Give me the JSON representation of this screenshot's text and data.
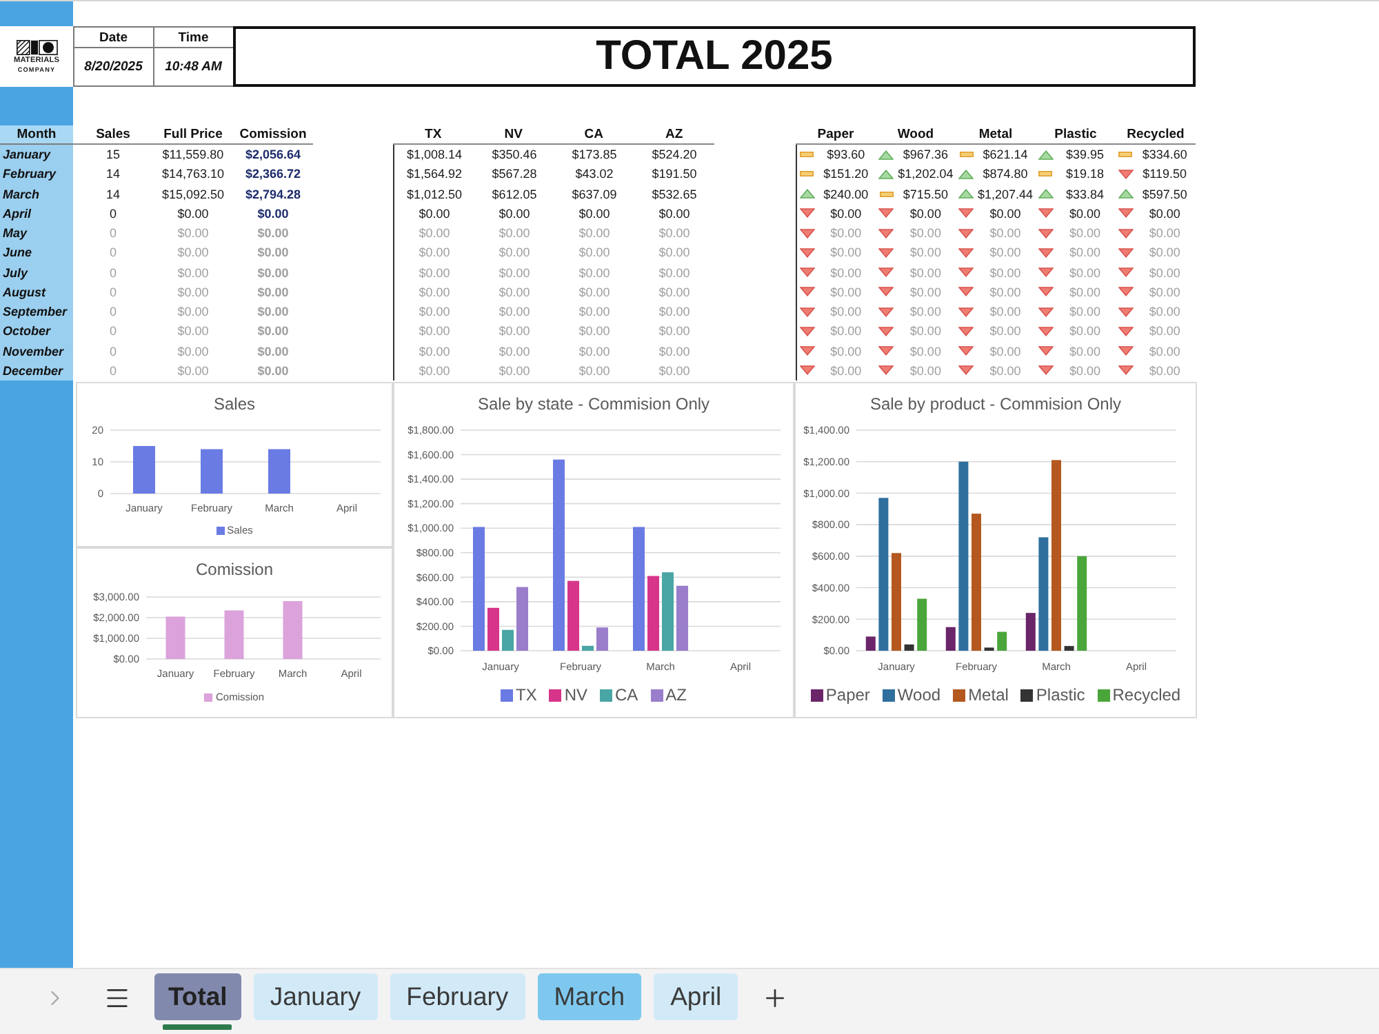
{
  "header": {
    "logo_lines": [
      "MATERIALS",
      "COMPANY"
    ],
    "date_label": "Date",
    "time_label": "Time",
    "date": "8/20/2025",
    "time": "10:48 AM",
    "title": "TOTAL 2025"
  },
  "summary_table": {
    "columns": [
      "Month",
      "Sales",
      "Full Price",
      "Comission"
    ],
    "rows": [
      {
        "month": "January",
        "sales": "15",
        "full_price": "$11,559.80",
        "comission": "$2,056.64",
        "muted": false
      },
      {
        "month": "February",
        "sales": "14",
        "full_price": "$14,763.10",
        "comission": "$2,366.72",
        "muted": false
      },
      {
        "month": "March",
        "sales": "14",
        "full_price": "$15,092.50",
        "comission": "$2,794.28",
        "muted": false
      },
      {
        "month": "April",
        "sales": "0",
        "full_price": "$0.00",
        "comission": "$0.00",
        "muted": false
      },
      {
        "month": "May",
        "sales": "0",
        "full_price": "$0.00",
        "comission": "$0.00",
        "muted": true
      },
      {
        "month": "June",
        "sales": "0",
        "full_price": "$0.00",
        "comission": "$0.00",
        "muted": true
      },
      {
        "month": "July",
        "sales": "0",
        "full_price": "$0.00",
        "comission": "$0.00",
        "muted": true
      },
      {
        "month": "August",
        "sales": "0",
        "full_price": "$0.00",
        "comission": "$0.00",
        "muted": true
      },
      {
        "month": "September",
        "sales": "0",
        "full_price": "$0.00",
        "comission": "$0.00",
        "muted": true
      },
      {
        "month": "October",
        "sales": "0",
        "full_price": "$0.00",
        "comission": "$0.00",
        "muted": true
      },
      {
        "month": "November",
        "sales": "0",
        "full_price": "$0.00",
        "comission": "$0.00",
        "muted": true
      },
      {
        "month": "December",
        "sales": "0",
        "full_price": "$0.00",
        "comission": "$0.00",
        "muted": true
      }
    ]
  },
  "state_table": {
    "columns": [
      "TX",
      "NV",
      "CA",
      "AZ"
    ],
    "rows": [
      {
        "values": [
          "$1,008.14",
          "$350.46",
          "$173.85",
          "$524.20"
        ],
        "muted": false
      },
      {
        "values": [
          "$1,564.92",
          "$567.28",
          "$43.02",
          "$191.50"
        ],
        "muted": false
      },
      {
        "values": [
          "$1,012.50",
          "$612.05",
          "$637.09",
          "$532.65"
        ],
        "muted": false
      },
      {
        "values": [
          "$0.00",
          "$0.00",
          "$0.00",
          "$0.00"
        ],
        "muted": false
      },
      {
        "values": [
          "$0.00",
          "$0.00",
          "$0.00",
          "$0.00"
        ],
        "muted": true
      },
      {
        "values": [
          "$0.00",
          "$0.00",
          "$0.00",
          "$0.00"
        ],
        "muted": true
      },
      {
        "values": [
          "$0.00",
          "$0.00",
          "$0.00",
          "$0.00"
        ],
        "muted": true
      },
      {
        "values": [
          "$0.00",
          "$0.00",
          "$0.00",
          "$0.00"
        ],
        "muted": true
      },
      {
        "values": [
          "$0.00",
          "$0.00",
          "$0.00",
          "$0.00"
        ],
        "muted": true
      },
      {
        "values": [
          "$0.00",
          "$0.00",
          "$0.00",
          "$0.00"
        ],
        "muted": true
      },
      {
        "values": [
          "$0.00",
          "$0.00",
          "$0.00",
          "$0.00"
        ],
        "muted": true
      },
      {
        "values": [
          "$0.00",
          "$0.00",
          "$0.00",
          "$0.00"
        ],
        "muted": true
      }
    ]
  },
  "product_table": {
    "columns": [
      "Paper",
      "Wood",
      "Metal",
      "Plastic",
      "Recycled"
    ],
    "rows": [
      {
        "cells": [
          {
            "value": "$93.60",
            "kind": "flat"
          },
          {
            "value": "$967.36",
            "kind": "up"
          },
          {
            "value": "$621.14",
            "kind": "flat"
          },
          {
            "value": "$39.95",
            "kind": "up"
          },
          {
            "value": "$334.60",
            "kind": "flat"
          }
        ],
        "muted": false
      },
      {
        "cells": [
          {
            "value": "$151.20",
            "kind": "flat"
          },
          {
            "value": "$1,202.04",
            "kind": "up"
          },
          {
            "value": "$874.80",
            "kind": "up"
          },
          {
            "value": "$19.18",
            "kind": "flat"
          },
          {
            "value": "$119.50",
            "kind": "down"
          }
        ],
        "muted": false
      },
      {
        "cells": [
          {
            "value": "$240.00",
            "kind": "up"
          },
          {
            "value": "$715.50",
            "kind": "flat"
          },
          {
            "value": "$1,207.44",
            "kind": "up"
          },
          {
            "value": "$33.84",
            "kind": "up"
          },
          {
            "value": "$597.50",
            "kind": "up"
          }
        ],
        "muted": false
      },
      {
        "cells": [
          {
            "value": "$0.00",
            "kind": "down"
          },
          {
            "value": "$0.00",
            "kind": "down"
          },
          {
            "value": "$0.00",
            "kind": "down"
          },
          {
            "value": "$0.00",
            "kind": "down"
          },
          {
            "value": "$0.00",
            "kind": "down"
          }
        ],
        "muted": false
      },
      {
        "cells": [
          {
            "value": "$0.00",
            "kind": "down"
          },
          {
            "value": "$0.00",
            "kind": "down"
          },
          {
            "value": "$0.00",
            "kind": "down"
          },
          {
            "value": "$0.00",
            "kind": "down"
          },
          {
            "value": "$0.00",
            "kind": "down"
          }
        ],
        "muted": true
      },
      {
        "cells": [
          {
            "value": "$0.00",
            "kind": "down"
          },
          {
            "value": "$0.00",
            "kind": "down"
          },
          {
            "value": "$0.00",
            "kind": "down"
          },
          {
            "value": "$0.00",
            "kind": "down"
          },
          {
            "value": "$0.00",
            "kind": "down"
          }
        ],
        "muted": true
      },
      {
        "cells": [
          {
            "value": "$0.00",
            "kind": "down"
          },
          {
            "value": "$0.00",
            "kind": "down"
          },
          {
            "value": "$0.00",
            "kind": "down"
          },
          {
            "value": "$0.00",
            "kind": "down"
          },
          {
            "value": "$0.00",
            "kind": "down"
          }
        ],
        "muted": true
      },
      {
        "cells": [
          {
            "value": "$0.00",
            "kind": "down"
          },
          {
            "value": "$0.00",
            "kind": "down"
          },
          {
            "value": "$0.00",
            "kind": "down"
          },
          {
            "value": "$0.00",
            "kind": "down"
          },
          {
            "value": "$0.00",
            "kind": "down"
          }
        ],
        "muted": true
      },
      {
        "cells": [
          {
            "value": "$0.00",
            "kind": "down"
          },
          {
            "value": "$0.00",
            "kind": "down"
          },
          {
            "value": "$0.00",
            "kind": "down"
          },
          {
            "value": "$0.00",
            "kind": "down"
          },
          {
            "value": "$0.00",
            "kind": "down"
          }
        ],
        "muted": true
      },
      {
        "cells": [
          {
            "value": "$0.00",
            "kind": "down"
          },
          {
            "value": "$0.00",
            "kind": "down"
          },
          {
            "value": "$0.00",
            "kind": "down"
          },
          {
            "value": "$0.00",
            "kind": "down"
          },
          {
            "value": "$0.00",
            "kind": "down"
          }
        ],
        "muted": true
      },
      {
        "cells": [
          {
            "value": "$0.00",
            "kind": "down"
          },
          {
            "value": "$0.00",
            "kind": "down"
          },
          {
            "value": "$0.00",
            "kind": "down"
          },
          {
            "value": "$0.00",
            "kind": "down"
          },
          {
            "value": "$0.00",
            "kind": "down"
          }
        ],
        "muted": true
      },
      {
        "cells": [
          {
            "value": "$0.00",
            "kind": "down"
          },
          {
            "value": "$0.00",
            "kind": "down"
          },
          {
            "value": "$0.00",
            "kind": "down"
          },
          {
            "value": "$0.00",
            "kind": "down"
          },
          {
            "value": "$0.00",
            "kind": "down"
          }
        ],
        "muted": true
      }
    ]
  },
  "charts": [
    {
      "chart_data": {
        "type": "bar",
        "title": "Sales",
        "categories": [
          "January",
          "February",
          "March",
          "April"
        ],
        "series": [
          {
            "name": "Sales",
            "color": "#6a7be3",
            "values": [
              15,
              14,
              14,
              0
            ]
          }
        ],
        "ylim": [
          0,
          20
        ],
        "yticks": [
          {
            "value": 0,
            "label": "0"
          },
          {
            "value": 10,
            "label": "10"
          },
          {
            "value": 20,
            "label": "20"
          }
        ],
        "grid": true,
        "legend": true
      }
    },
    {
      "chart_data": {
        "type": "bar",
        "title": "Comission",
        "categories": [
          "January",
          "February",
          "March",
          "April"
        ],
        "series": [
          {
            "name": "Comission",
            "color": "#dba2db",
            "values": [
              2050,
              2350,
              2800,
              0
            ]
          }
        ],
        "ylim": [
          0,
          3000
        ],
        "yticks": [
          {
            "value": 0,
            "label": "$0.00"
          },
          {
            "value": 1000,
            "label": "$1,000.00"
          },
          {
            "value": 2000,
            "label": "$2,000.00"
          },
          {
            "value": 3000,
            "label": "$3,000.00"
          }
        ],
        "grid": true,
        "legend": true
      }
    },
    {
      "chart_data": {
        "type": "bar",
        "title": "Sale by state - Commision Only",
        "categories": [
          "January",
          "February",
          "March",
          "April"
        ],
        "series": [
          {
            "name": "TX",
            "color": "#6a7be3",
            "values": [
              1010,
              1560,
              1010,
              0
            ]
          },
          {
            "name": "NV",
            "color": "#d6358a",
            "values": [
              350,
              570,
              610,
              0
            ]
          },
          {
            "name": "CA",
            "color": "#4aa5a5",
            "values": [
              170,
              40,
              640,
              0
            ]
          },
          {
            "name": "AZ",
            "color": "#9a7dcb",
            "values": [
              520,
              190,
              530,
              0
            ]
          }
        ],
        "ylim": [
          0,
          1800
        ],
        "yticks": [
          {
            "value": 0,
            "label": "$0.00"
          },
          {
            "value": 200,
            "label": "$200.00"
          },
          {
            "value": 400,
            "label": "$400.00"
          },
          {
            "value": 600,
            "label": "$600.00"
          },
          {
            "value": 800,
            "label": "$800.00"
          },
          {
            "value": 1000,
            "label": "$1,000.00"
          },
          {
            "value": 1200,
            "label": "$1,200.00"
          },
          {
            "value": 1400,
            "label": "$1,400.00"
          },
          {
            "value": 1600,
            "label": "$1,600.00"
          },
          {
            "value": 1800,
            "label": "$1,800.00"
          }
        ],
        "grid": true,
        "legend": true
      }
    },
    {
      "chart_data": {
        "type": "bar",
        "title": "Sale by product - Commision Only",
        "categories": [
          "January",
          "February",
          "March",
          "April"
        ],
        "series": [
          {
            "name": "Paper",
            "color": "#6b2669",
            "values": [
              90,
              150,
              240,
              0
            ]
          },
          {
            "name": "Wood",
            "color": "#2e6f9e",
            "values": [
              970,
              1200,
              720,
              0
            ]
          },
          {
            "name": "Metal",
            "color": "#b4581f",
            "values": [
              620,
              870,
              1210,
              0
            ]
          },
          {
            "name": "Plastic",
            "color": "#333333",
            "values": [
              40,
              20,
              30,
              0
            ]
          },
          {
            "name": "Recycled",
            "color": "#4aa63a",
            "values": [
              330,
              120,
              600,
              0
            ]
          }
        ],
        "ylim": [
          0,
          1400
        ],
        "yticks": [
          {
            "value": 0,
            "label": "$0.00"
          },
          {
            "value": 200,
            "label": "$200.00"
          },
          {
            "value": 400,
            "label": "$400.00"
          },
          {
            "value": 600,
            "label": "$600.00"
          },
          {
            "value": 800,
            "label": "$800.00"
          },
          {
            "value": 1000,
            "label": "$1,000.00"
          },
          {
            "value": 1200,
            "label": "$1,200.00"
          },
          {
            "value": 1400,
            "label": "$1,400.00"
          }
        ],
        "grid": true,
        "legend": true
      }
    }
  ],
  "sheet_tabs": [
    {
      "label": "Total",
      "selected": true,
      "color": "#8189ad"
    },
    {
      "label": "January",
      "selected": false,
      "color": "#d2eaf8"
    },
    {
      "label": "February",
      "selected": false,
      "color": "#d2eaf8"
    },
    {
      "label": "March",
      "selected": false,
      "color": "#7ec8ef"
    },
    {
      "label": "April",
      "selected": false,
      "color": "#d2eaf8"
    }
  ]
}
